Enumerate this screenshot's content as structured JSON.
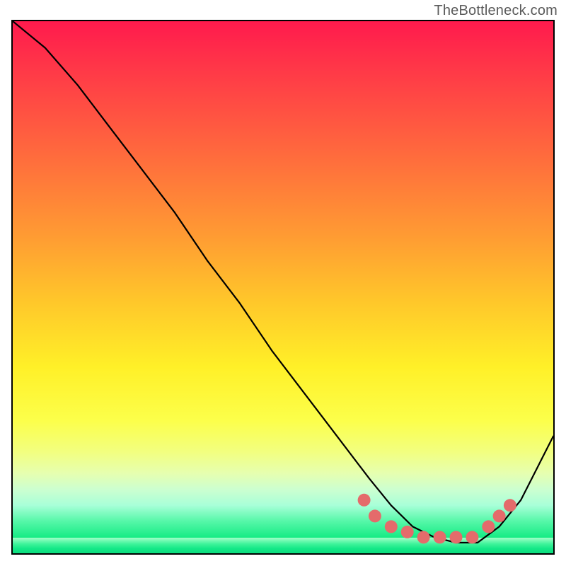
{
  "watermark": "TheBottleneck.com",
  "chart_data": {
    "type": "line",
    "title": "",
    "xlabel": "",
    "ylabel": "",
    "xlim": [
      0,
      100
    ],
    "ylim": [
      0,
      100
    ],
    "grid": false,
    "background": "heat-gradient",
    "series": [
      {
        "name": "bottleneck-curve",
        "x": [
          0,
          6,
          12,
          18,
          24,
          30,
          36,
          42,
          48,
          54,
          60,
          66,
          70,
          74,
          78,
          82,
          86,
          90,
          94,
          100
        ],
        "y": [
          100,
          95,
          88,
          80,
          72,
          64,
          55,
          47,
          38,
          30,
          22,
          14,
          9,
          5,
          3,
          2,
          2,
          5,
          10,
          22
        ],
        "stroke": "#000000"
      }
    ],
    "markers": {
      "name": "scatter-dots",
      "color": "#e46b6b",
      "points": [
        {
          "x": 65,
          "y": 10
        },
        {
          "x": 67,
          "y": 7
        },
        {
          "x": 70,
          "y": 5
        },
        {
          "x": 73,
          "y": 4
        },
        {
          "x": 76,
          "y": 3
        },
        {
          "x": 79,
          "y": 3
        },
        {
          "x": 82,
          "y": 3
        },
        {
          "x": 85,
          "y": 3
        },
        {
          "x": 88,
          "y": 5
        },
        {
          "x": 90,
          "y": 7
        },
        {
          "x": 92,
          "y": 9
        }
      ]
    }
  }
}
